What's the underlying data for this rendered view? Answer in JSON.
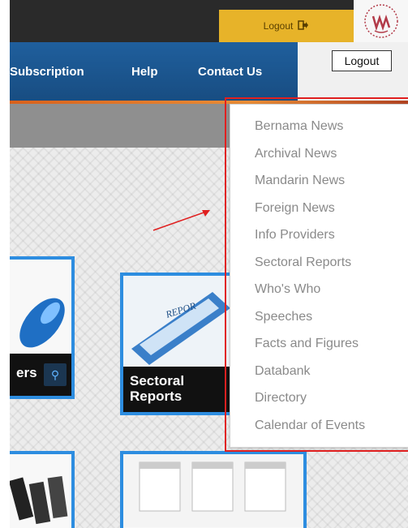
{
  "header": {
    "logout_label": "Logout",
    "logout_icon": "sign-out-icon"
  },
  "nav": {
    "items": [
      {
        "label": "Subscription"
      },
      {
        "label": "Help"
      },
      {
        "label": "Contact Us"
      }
    ]
  },
  "tooltip": {
    "text": "Logout"
  },
  "dropdown": {
    "items": [
      "Bernama News",
      "Archival News",
      "Mandarin News",
      "Foreign News",
      "Info Providers",
      "Sectoral Reports",
      "Who's Who",
      "Speeches",
      "Facts and Figures",
      "Databank",
      "Directory",
      "Calendar of Events"
    ]
  },
  "tiles": {
    "left_label": "ers",
    "sectoral_line1": "Sectoral",
    "sectoral_line2": "Reports",
    "report_image_text": "REPOR"
  },
  "colors": {
    "nav_blue": "#1f5f9d",
    "logout_yellow": "#e7b329",
    "highlight_red": "#e02020",
    "tile_border": "#2d8de0"
  }
}
